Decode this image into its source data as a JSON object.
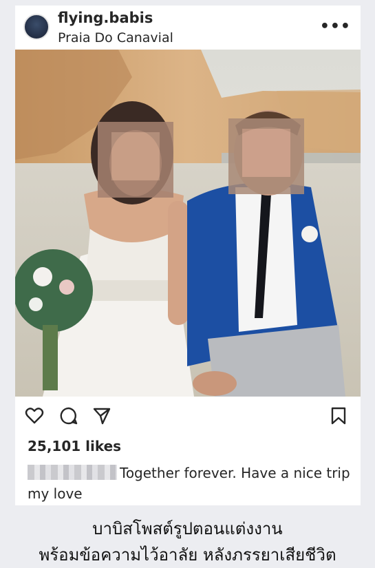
{
  "post": {
    "username": "flying.babis",
    "location": "Praia Do Canavial",
    "more_label": "•••",
    "likes": "25,101 likes",
    "caption_text": "Together forever. Have a nice trip my love"
  },
  "headline": {
    "line1": "บาบิสโพสต์รูปตอนแต่งงาน",
    "line2": "พร้อมข้อความไว้อาลัย หลังภรรยาเสียชีวิต"
  },
  "icons": [
    "heart-icon",
    "comment-icon",
    "share-icon",
    "bookmark-icon"
  ],
  "colors": {
    "text": "#262626",
    "background": "#ecedf1",
    "card": "#ffffff",
    "suit": "#1c4fa3"
  }
}
